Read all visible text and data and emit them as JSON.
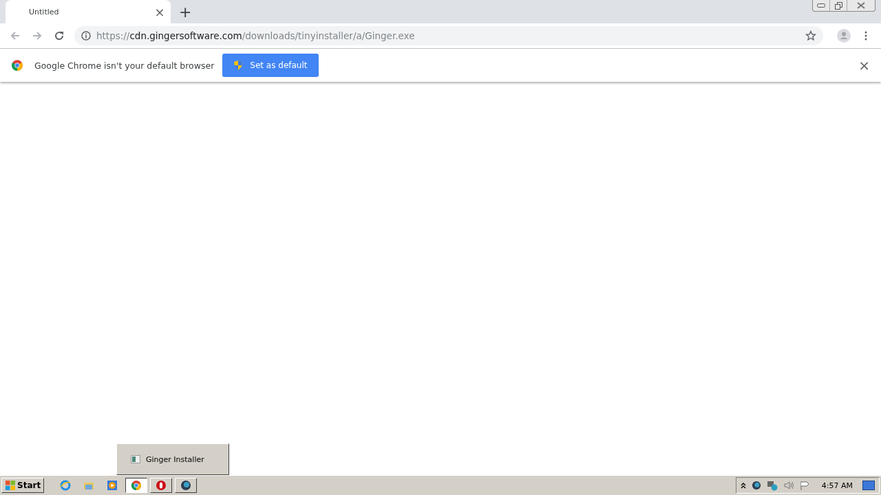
{
  "tabs": [
    {
      "title": "Untitled",
      "close": "×",
      "selected": true
    }
  ],
  "new_tab": "+",
  "address": {
    "scheme": "https://",
    "host": "cdn.gingersoftware.com",
    "path": "/downloads/tinyinstaller/a/Ginger.exe"
  },
  "infobar": {
    "message": "Google Chrome isn't your default browser",
    "button": "Set as default",
    "close": "×"
  },
  "taskbar_popup": {
    "title": "Ginger Installer"
  },
  "taskbar": {
    "start": "Start",
    "items": [
      {
        "kind": "ie",
        "selected": false
      },
      {
        "kind": "folder",
        "selected": false
      },
      {
        "kind": "media",
        "selected": false
      },
      {
        "kind": "chrome",
        "selected": true
      },
      {
        "kind": "opera",
        "selected": false
      },
      {
        "kind": "app",
        "selected": false
      }
    ],
    "clock": "4:57 AM"
  }
}
